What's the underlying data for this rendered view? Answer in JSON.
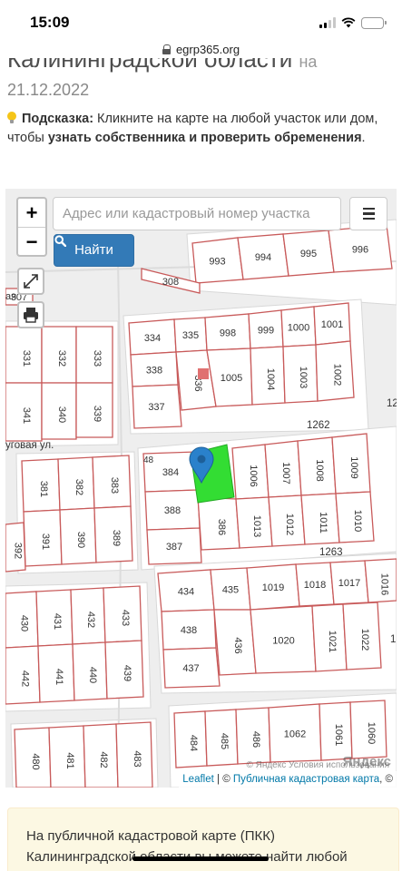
{
  "status_bar": {
    "time": "15:09"
  },
  "browser": {
    "url": "egrp365.org"
  },
  "page": {
    "heading_line": "Калининградской области",
    "heading_suffix": "на",
    "date": "21.12.2022"
  },
  "hint": {
    "label": "Подсказка:",
    "text_1": " Кликните на карте на любой участок или дом, чтобы ",
    "bold": "узнать собственника и проверить обременения",
    "text_2": "."
  },
  "map": {
    "zoom_in": "+",
    "zoom_out": "−",
    "search_placeholder": "Адрес или кадастровый номер участка",
    "find_button": "Найти",
    "attribution_leaflet": "Leaflet",
    "attribution_separator": " | © ",
    "attribution_pkk": "Публичная кадастровая карта",
    "attribution_trail": ", ©",
    "yandex_logo": "Яндекс",
    "yandex_terms": "© Яндекс  Условия использования",
    "street_label": "уговая ул.",
    "partial_label": "ая",
    "colors": {
      "parcel_fill": "#ffffff",
      "parcel_border": "#c85a5a",
      "road": "#ebebeb",
      "selected_parcel": "#33dd33",
      "marker": "#2a81cb"
    },
    "parcels": [
      {
        "label": "993"
      },
      {
        "label": "994"
      },
      {
        "label": "995"
      },
      {
        "label": "996"
      },
      {
        "label": "308"
      },
      {
        "label": "307"
      },
      {
        "label": "334"
      },
      {
        "label": "335"
      },
      {
        "label": "998"
      },
      {
        "label": "999"
      },
      {
        "label": "1000"
      },
      {
        "label": "1001"
      },
      {
        "label": "338"
      },
      {
        "label": "336"
      },
      {
        "label": "1005"
      },
      {
        "label": "1004"
      },
      {
        "label": "1003"
      },
      {
        "label": "1002"
      },
      {
        "label": "337"
      },
      {
        "label": "331"
      },
      {
        "label": "332"
      },
      {
        "label": "333"
      },
      {
        "label": "341"
      },
      {
        "label": "340"
      },
      {
        "label": "339"
      },
      {
        "label": "1262"
      },
      {
        "label": "384"
      },
      {
        "label": "1006"
      },
      {
        "label": "1007"
      },
      {
        "label": "1008"
      },
      {
        "label": "1009"
      },
      {
        "label": "388"
      },
      {
        "label": "386"
      },
      {
        "label": "1013"
      },
      {
        "label": "1012"
      },
      {
        "label": "1011"
      },
      {
        "label": "1010"
      },
      {
        "label": "387"
      },
      {
        "label": "381"
      },
      {
        "label": "382"
      },
      {
        "label": "383"
      },
      {
        "label": "391"
      },
      {
        "label": "390"
      },
      {
        "label": "389"
      },
      {
        "label": "392"
      },
      {
        "label": "1263"
      },
      {
        "label": "434"
      },
      {
        "label": "435"
      },
      {
        "label": "1019"
      },
      {
        "label": "1018"
      },
      {
        "label": "1017"
      },
      {
        "label": "1016"
      },
      {
        "label": "438"
      },
      {
        "label": "436"
      },
      {
        "label": "1020"
      },
      {
        "label": "1021"
      },
      {
        "label": "1022"
      },
      {
        "label": "437"
      },
      {
        "label": "430"
      },
      {
        "label": "431"
      },
      {
        "label": "432"
      },
      {
        "label": "433"
      },
      {
        "label": "442"
      },
      {
        "label": "441"
      },
      {
        "label": "440"
      },
      {
        "label": "439"
      },
      {
        "label": "484"
      },
      {
        "label": "485"
      },
      {
        "label": "486"
      },
      {
        "label": "1062"
      },
      {
        "label": "1061"
      },
      {
        "label": "1060"
      },
      {
        "label": "480"
      },
      {
        "label": "481"
      },
      {
        "label": "482"
      },
      {
        "label": "483"
      },
      {
        "label": "12"
      },
      {
        "label": "1"
      },
      {
        "label": "48"
      }
    ]
  },
  "info_box": {
    "text": "На публичной кадастровой карте (ПКК) Калининградской области вы можете найти любой земельный участок, здание (дом) или сооружение"
  }
}
